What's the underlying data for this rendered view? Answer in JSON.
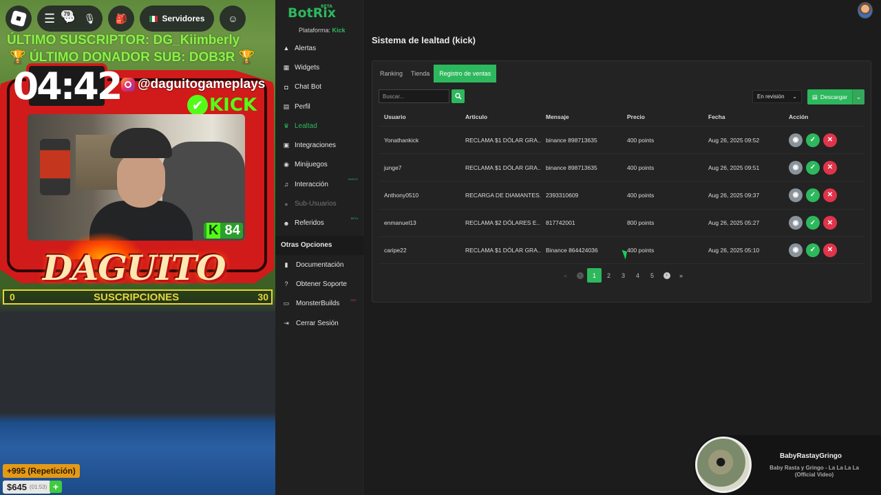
{
  "stream": {
    "notifications_badge": "79",
    "servers_label": "Servidores",
    "ticker_line1": "ÚLTIMO SUSCRIPTOR: DG_Kiimberly",
    "ticker_line2": "🏆 ÚLTIMO DONADOR SUB: DOB3R 🏆",
    "timer": "04:42",
    "instagram": "@daguitogameplays",
    "kick_label": "KICK",
    "kick_count": "84",
    "name_logo": "DAGUITO",
    "sub_goal": {
      "current": "0",
      "label": "SUSCRIPCIONES",
      "target": "30"
    },
    "donation_label": "+995 (Repetición)",
    "money": "$645",
    "money_time": "(01:53)"
  },
  "app": {
    "brand": "BotRix",
    "brand_tag": "BETA",
    "platform_label": "Plataforma:",
    "platform_value": "Kick",
    "accent_color": "#2db85d"
  },
  "sidebar": {
    "items": [
      {
        "label": "Alertas",
        "icon": "warning-icon"
      },
      {
        "label": "Widgets",
        "icon": "grid-icon"
      },
      {
        "label": "Chat Bot",
        "icon": "robot-icon"
      },
      {
        "label": "Perfil",
        "icon": "id-card-icon"
      },
      {
        "label": "Lealtad",
        "icon": "trophy-icon",
        "active": true
      },
      {
        "label": "Integraciones",
        "icon": "plug-icon"
      },
      {
        "label": "Minijuegos",
        "icon": "gamepad-icon"
      },
      {
        "label": "Interacción",
        "icon": "music-icon",
        "tag": "NUEVO"
      },
      {
        "label": "Sub-Usuarios",
        "icon": "users-icon",
        "disabled": true
      },
      {
        "label": "Referidos",
        "icon": "group-icon",
        "tag": "BETA"
      }
    ],
    "section_title": "Otras Opciones",
    "other": [
      {
        "label": "Documentación",
        "icon": "book-icon"
      },
      {
        "label": "Obtener Soporte",
        "icon": "help-icon"
      },
      {
        "label": "MonsterBuilds",
        "icon": "laptop-icon",
        "tag": "HOT"
      },
      {
        "label": "Cerrar Sesión",
        "icon": "logout-icon"
      }
    ]
  },
  "page": {
    "title": "Sistema de lealtad (kick)",
    "tabs": [
      "Ranking",
      "Tienda",
      "Registro de ventas"
    ],
    "search_placeholder": "Buscar...",
    "status_filter": "En revisión",
    "download_label": "Descargar"
  },
  "table": {
    "headers": [
      "Usuario",
      "Artículo",
      "Mensaje",
      "Precio",
      "Fecha",
      "Acción"
    ],
    "rows": [
      {
        "user": "Yonathankick",
        "item": "RECLAMA $1 DÓLAR GRA...",
        "message": "binance 898713635",
        "price": "400 points",
        "date": "Aug 26, 2025 09:52"
      },
      {
        "user": "junge7",
        "item": "RECLAMA $1 DÓLAR GRA...",
        "message": "binance 898713635",
        "price": "400 points",
        "date": "Aug 26, 2025 09:51"
      },
      {
        "user": "Anthony0510",
        "item": "RECARGA DE DIAMANTES...",
        "message": "2393310609",
        "price": "400 points",
        "date": "Aug 26, 2025 09:37"
      },
      {
        "user": "enmanuel13",
        "item": "RECLAMA $2 DÓLARES E...",
        "message": "817742001",
        "price": "800 points",
        "date": "Aug 26, 2025 05:27"
      },
      {
        "user": "caripe22",
        "item": "RECLAMA $1 DÓLAR GRA...",
        "message": "Binance 864424036",
        "price": "400 points",
        "date": "Aug 26, 2025 05:10"
      }
    ]
  },
  "pagination": {
    "first": "«",
    "prev": "‹",
    "pages": [
      "1",
      "2",
      "3",
      "4",
      "5"
    ],
    "current": "1",
    "next": "›",
    "last": "»"
  },
  "now_playing": {
    "title": "BabyRastayGringo",
    "subtitle": "Baby Rasta y Gringo - La La La La (Official Video)"
  }
}
